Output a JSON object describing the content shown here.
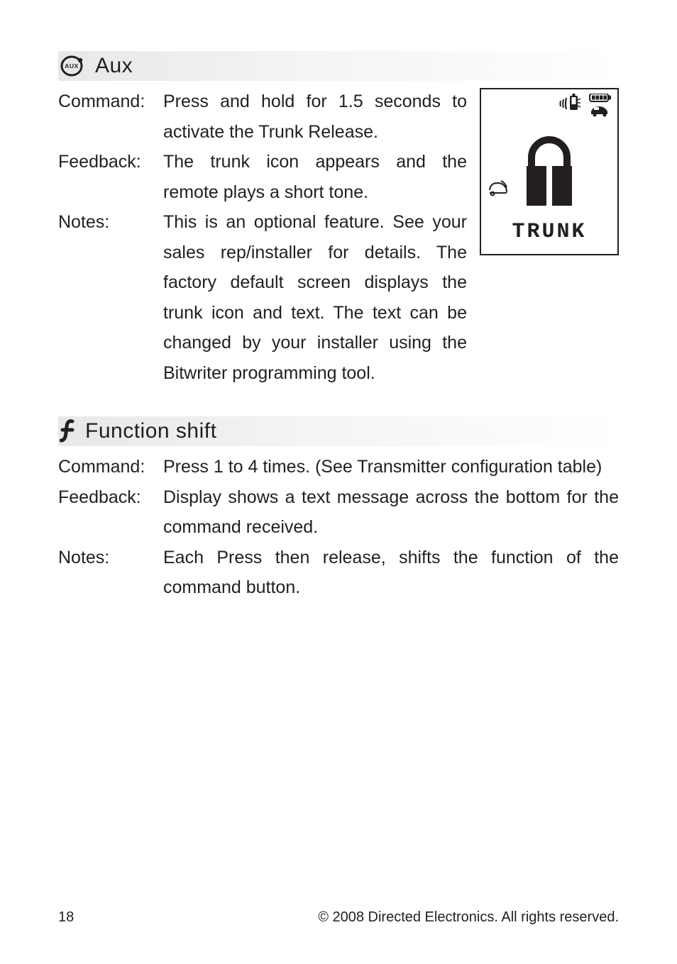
{
  "sections": {
    "aux": {
      "title": "Aux",
      "command_label": "Command:",
      "command_prefix": "Press",
      "command_mid": " and ",
      "command_bold2": "hold",
      "command_rest": " for 1.5 seconds to activate the Trunk Release.",
      "feedback_label": "Feedback:",
      "feedback_text": "The trunk icon appears and the remote plays a short tone.",
      "notes_label": "Notes:",
      "notes_text": "This is an optional feature. See your sales rep/installer for details. The factory default screen displays the trunk icon and text. The text can be changed by your installer using the Bitwriter programming tool.",
      "screen_text": "TRUNK"
    },
    "func": {
      "title": "Function shift",
      "command_label": "Command:",
      "command_prefix": "Press",
      "command_rest": " 1 to 4 times. (See Transmitter configuration table)",
      "feedback_label": "Feedback:",
      "feedback_text": "Display shows a text message across the bottom for the command received.",
      "notes_label": "Notes:",
      "notes_text": "Each Press then release, shifts the function of the command button."
    }
  },
  "footer": {
    "page": "18",
    "copyright": "© 2008 Directed Electronics. All rights reserved."
  }
}
